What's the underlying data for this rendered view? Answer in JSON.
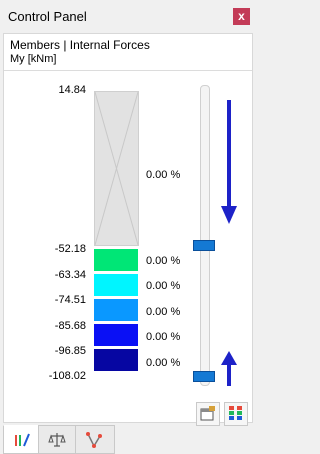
{
  "window": {
    "title": "Control Panel",
    "close_label": "x"
  },
  "panel": {
    "title": "Members | Internal Forces",
    "unit_label": "My [kNm]"
  },
  "scale": {
    "top_value": "14.84",
    "top_range_percent": "0.00 %",
    "entries": [
      {
        "value": "-52.18",
        "color": "#00e676",
        "percent": "0.00 %"
      },
      {
        "value": "-63.34",
        "color": "#00f5ff",
        "percent": "0.00 %"
      },
      {
        "value": "-74.51",
        "color": "#0a98ff",
        "percent": "0.00 %"
      },
      {
        "value": "-85.68",
        "color": "#0a10f5",
        "percent": "0.00 %"
      },
      {
        "value": "-96.85",
        "color": "#0606a2",
        "percent": ""
      }
    ],
    "bottom_value": "-108.02",
    "filler_color": "#e2e2e2"
  },
  "slider": {
    "accent": "#1479d4",
    "arrow_color": "#1d22c8",
    "upper_handle_fraction": 0.55,
    "lower_handle_fraction": 0.98
  },
  "tools": {
    "settings_icon": "display-settings-icon",
    "scale_icon": "color-scale-icon"
  },
  "tabs": [
    {
      "icon": "color-scale-pen-icon",
      "active": true
    },
    {
      "icon": "balance-scale-icon",
      "active": false
    },
    {
      "icon": "members-filter-icon",
      "active": false
    }
  ]
}
